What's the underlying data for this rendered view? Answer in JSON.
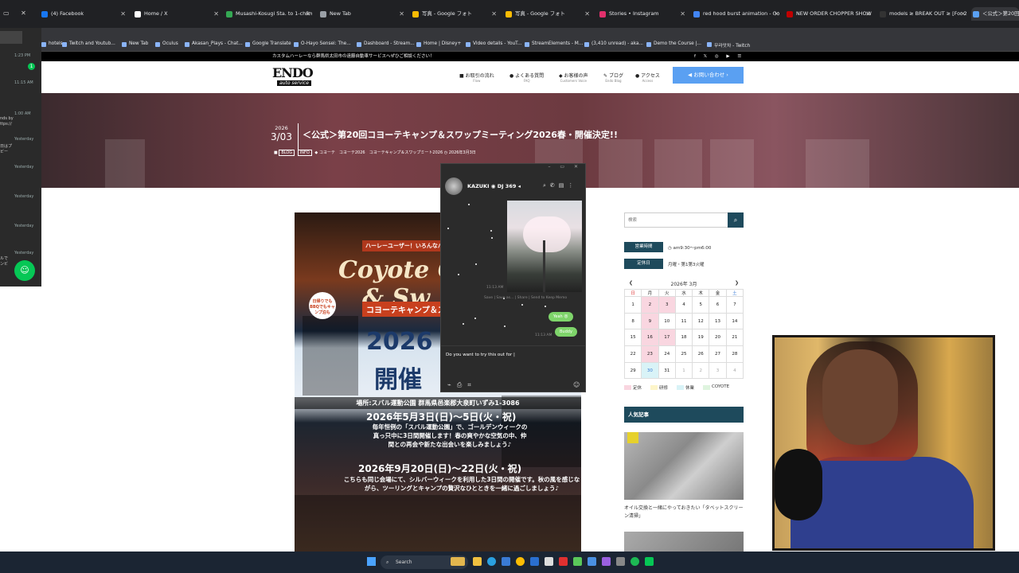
{
  "browser": {
    "tabs": [
      {
        "title": "(4) Facebook",
        "color": "#1877f2"
      },
      {
        "title": "Home / X",
        "color": "#ffffff"
      },
      {
        "title": "Musashi-Kosugi Sta. to 1-chōm",
        "color": "#34a853"
      },
      {
        "title": "New Tab",
        "color": "#9aa0a6"
      },
      {
        "title": "写真 - Google フォト",
        "color": "#fbbc04"
      },
      {
        "title": "写真 - Google フォト",
        "color": "#fbbc04"
      },
      {
        "title": "Stories • Instagram",
        "color": "#e1306c"
      },
      {
        "title": "red hood burst animation - Go",
        "color": "#4285f4"
      },
      {
        "title": "NEW ORDER CHOPPER SHOW",
        "color": "#c00000"
      },
      {
        "title": "models ≥ BREAK OUT ≥ [For 20",
        "color": "#333333"
      },
      {
        "title": "＜公式＞第20回",
        "color": "#5aa0f2"
      }
    ],
    "bookmarks": [
      "hotels",
      "Twitch and Youtub...",
      "New Tab",
      "Oculus",
      "Akasan_Plays - Chat...",
      "Google Translate",
      "O-Hayo Sensei: The...",
      "Dashboard - Stream...",
      "Home | Disney+",
      "Video details - YouT...",
      "StreamElements - M...",
      "(3,410 unread) - aka...",
      "Demo the Course |...",
      "무라앗차 - Twitch"
    ]
  },
  "left_panel": {
    "times": [
      "1:23 PM",
      "11:15 AM",
      "1:00 AM",
      "Yesterday",
      "Yesterday",
      "Yesterday",
      "Yesterday",
      "Yesterday"
    ],
    "badge": "1",
    "snippets": [
      "nds by",
      "ttps://",
      "日はプ",
      "ビー",
      "ルで",
      "ンビ"
    ]
  },
  "site": {
    "promo": "カスタムハーレーなら群馬県太田市の遠藤自動車サービスへぜひご相談ください！",
    "social": "f 𝕏 ◎ ▶ ☰",
    "logo_main": "ENDO",
    "logo_sub": "auto service",
    "nav": [
      {
        "label": "お取引の流れ",
        "sub": "Flow",
        "icon": "■"
      },
      {
        "label": "よくある質問",
        "sub": "FAQ",
        "icon": "●"
      },
      {
        "label": "お客様の声",
        "sub": "Customers Voice",
        "icon": "◆"
      },
      {
        "label": "ブログ",
        "sub": "Endo Blog",
        "icon": "✎"
      },
      {
        "label": "アクセス",
        "sub": "Access",
        "icon": "●"
      }
    ],
    "cta": "◀ お問い合わせ ›",
    "hero": {
      "year": "2026",
      "date": "3/03",
      "title": "＜公式＞第20回コヨーテキャンプ＆スワップミーティング2026春・開催決定!!",
      "tags": [
        "BLOG",
        "INFO"
      ],
      "categories": "◆ コヨーテ　コヨーテ2026　コヨーテキャンプ＆スワップミート2026",
      "posted": "◷ 2026年3月3日"
    },
    "poster": {
      "intro": "ハーレーユーザー！いろんなバイクや車でも楽しい",
      "coyote": "Coyote C",
      "swap": "& Sw",
      "jp_title": "コヨーテキャンプ＆ス",
      "year": "2026",
      "kaisai": "開催",
      "venue": "場所:スバル運動公園 群馬県邑楽郡大泉町いずみ1-3086",
      "date1": "2026年5月3日(日)〜5日(火・祝)",
      "body1": "毎年恒例の「スバル運動公園」で、ゴールデンウィークの真っ只中に3日間開催します！春の爽やかな空気の中、仲間との再会や新たな出会いを楽しみましょう♪",
      "date2": "2026年9月20日(日)〜22日(火・祝)",
      "body2": "こちらも同じ会場にて、シルバーウィークを利用した3日間の開催です。秋の風を感じながら、ツーリングとキャンプの贅沢なひとときを一緒に過ごしましょう♪",
      "bubble": "日帰りでもBBQでもキャンプ泊も"
    },
    "sidebar": {
      "search_placeholder": "検索",
      "hours_label": "営業時間",
      "hours_value": "◷ am9:30〜pm6:00",
      "closed_label": "定休日",
      "closed_value": "月曜・第1第3火曜",
      "calendar": {
        "title": "2026年 3月",
        "prev": "❮",
        "next": "❯",
        "weekdays": [
          "日",
          "月",
          "火",
          "水",
          "木",
          "金",
          "土"
        ],
        "weeks": [
          [
            "1",
            "2",
            "3",
            "4",
            "5",
            "6",
            "7"
          ],
          [
            "8",
            "9",
            "10",
            "11",
            "12",
            "13",
            "14"
          ],
          [
            "15",
            "16",
            "17",
            "18",
            "19",
            "20",
            "21"
          ],
          [
            "22",
            "23",
            "24",
            "25",
            "26",
            "27",
            "28"
          ],
          [
            "29",
            "30",
            "31",
            "1",
            "2",
            "3",
            "4"
          ]
        ]
      },
      "legend": [
        {
          "label": "定休",
          "color": "#f9d6e0"
        },
        {
          "label": "研修",
          "color": "#fdf5c9"
        },
        {
          "label": "休業",
          "color": "#d9f3f7"
        },
        {
          "label": "COYOTE",
          "color": "#dff4df"
        }
      ],
      "popular_title": "人気記事",
      "popular_caption": "オイル交換と一緒にやっておきたい「タベットスクリーン清掃」"
    }
  },
  "chat": {
    "name": "KAZUKI",
    "status": "DJ 369",
    "photo_time": "11:13 AM",
    "photo_actions": "Save | Save as... | Share | Send to Keep Memo",
    "bubble1": "Yeah 😝",
    "bubble2": "Buddy",
    "time2": "11:13 AM",
    "input_text": "Do you want to try this out for |"
  },
  "taskbar": {
    "search": "Search"
  }
}
